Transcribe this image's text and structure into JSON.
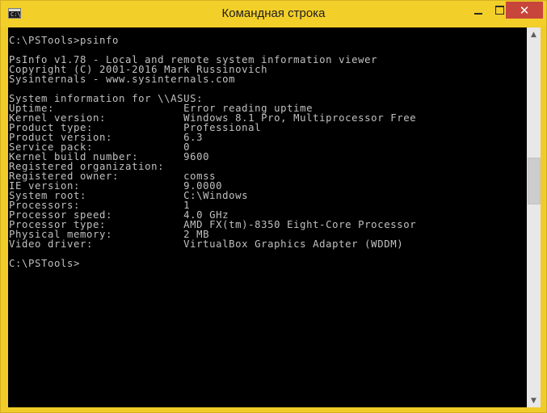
{
  "window": {
    "title": "Командная строка",
    "icon": "cmd-icon",
    "icon_prompt": "C:\\",
    "controls": {
      "minimize_icon": "minimize-icon",
      "maximize_icon": "maximize-icon",
      "close_icon": "close-icon",
      "close_glyph": "✕"
    }
  },
  "console": {
    "lines": [
      "C:\\PSTools>psinfo",
      "",
      "PsInfo v1.78 - Local and remote system information viewer",
      "Copyright (C) 2001-2016 Mark Russinovich",
      "Sysinternals - www.sysinternals.com",
      "",
      "System information for \\\\ASUS:",
      "Uptime:                    Error reading uptime",
      "Kernel version:            Windows 8.1 Pro, Multiprocessor Free",
      "Product type:              Professional",
      "Product version:           6.3",
      "Service pack:              0",
      "Kernel build number:       9600",
      "Registered organization:",
      "Registered owner:          comss",
      "IE version:                9.0000",
      "System root:               C:\\Windows",
      "Processors:                1",
      "Processor speed:           4.0 GHz",
      "Processor type:            AMD FX(tm)-8350 Eight-Core Processor",
      "Physical memory:           2 MB",
      "Video driver:              VirtualBox Graphics Adapter (WDDM)",
      "",
      "C:\\PSTools>"
    ]
  },
  "scrollbar": {
    "up_glyph": "▲",
    "down_glyph": "▼",
    "position": 0.38
  },
  "colors": {
    "titlebar": "#f3cf2a",
    "console_bg": "#000000",
    "console_fg": "#c0c0c0",
    "close_button": "#c7453a"
  }
}
